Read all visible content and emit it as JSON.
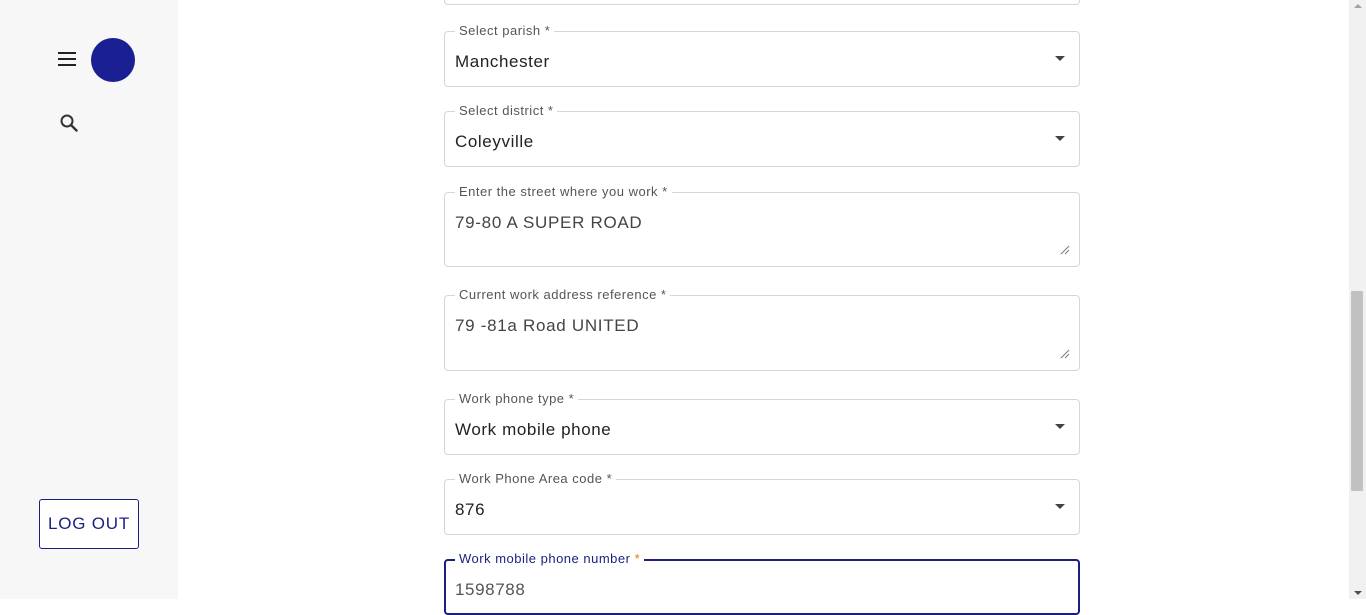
{
  "sidebar": {
    "menu_icon": "hamburger-menu-icon",
    "avatar_color": "#1a1f94",
    "search_icon": "search-icon",
    "logout_label": "LOG OUT"
  },
  "form": {
    "parish": {
      "label": "Select parish *",
      "value": "Manchester"
    },
    "district": {
      "label": "Select district *",
      "value": "Coleyville"
    },
    "street": {
      "label": "Enter the street where you work *",
      "value": "79-80 A SUPER ROAD"
    },
    "reference": {
      "label": "Current work address reference *",
      "value": "79 -81a Road UNITED"
    },
    "phone_type": {
      "label": "Work phone type *",
      "value": "Work mobile phone"
    },
    "area_code": {
      "label": "Work Phone Area code *",
      "value": "876"
    },
    "mobile_number": {
      "label": "Work mobile phone number",
      "required_mark": "*",
      "value": "1598788"
    }
  },
  "colors": {
    "accent": "#1a1f80",
    "required_focused": "#e07b00",
    "sidebar_bg": "#f7f7f7"
  }
}
